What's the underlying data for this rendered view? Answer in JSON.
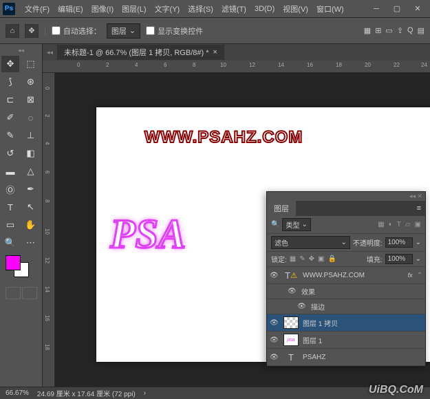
{
  "menubar": {
    "items": [
      "文件(F)",
      "编辑(E)",
      "图像(I)",
      "图层(L)",
      "文字(Y)",
      "选择(S)",
      "滤镜(T)",
      "3D(D)",
      "视图(V)",
      "窗口(W)"
    ]
  },
  "optbar": {
    "auto_select": "自动选择：",
    "target": "图层",
    "show_transform": "显示变换控件"
  },
  "doc": {
    "tab_title": "未标题-1 @ 66.7% (图层 1 拷贝, RGB/8#) *"
  },
  "ruler_h": [
    "0",
    "2",
    "4",
    "6",
    "8",
    "10",
    "12",
    "14",
    "16",
    "18",
    "20",
    "22",
    "24"
  ],
  "ruler_v": [
    "0",
    "2",
    "4",
    "6",
    "8",
    "10",
    "12",
    "14",
    "16",
    "18"
  ],
  "canvas": {
    "text1": "WWW.PSAHZ.COM",
    "text2": "PSA"
  },
  "layers_panel": {
    "tab": "图层",
    "kind_label": "类型",
    "blend_mode": "滤色",
    "opacity_label": "不透明度:",
    "opacity_value": "100%",
    "lock_label": "锁定:",
    "fill_label": "填充:",
    "fill_value": "100%",
    "layers": [
      {
        "name": "WWW.PSAHZ.COM",
        "type": "text",
        "fx": true
      },
      {
        "name": "效果",
        "type": "sub"
      },
      {
        "name": "描边",
        "type": "sub2"
      },
      {
        "name": "图层 1 拷贝",
        "type": "raster",
        "selected": true
      },
      {
        "name": "图层 1",
        "type": "raster2"
      },
      {
        "name": "PSAHZ",
        "type": "text"
      }
    ]
  },
  "status": {
    "zoom": "66.67%",
    "dims": "24.69 厘米 x 17.64 厘米 (72 ppi)"
  },
  "watermark": "UiBQ.CoM"
}
